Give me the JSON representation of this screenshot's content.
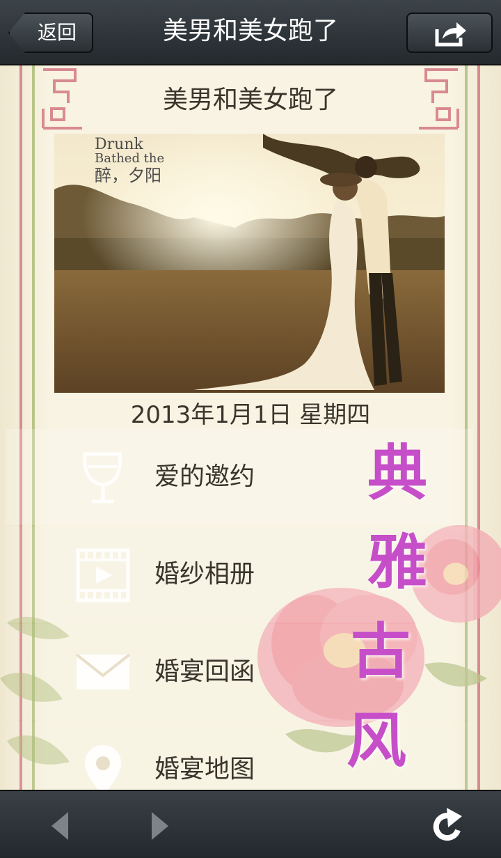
{
  "topbar": {
    "back_label": "返回",
    "title": "美男和美女跑了"
  },
  "card": {
    "heading": "美男和美女跑了",
    "photo_text": {
      "line1": "Drunk",
      "line2": "Bathed the",
      "line3": "醉，夕阳"
    },
    "date": "2013年1月1日 星期四"
  },
  "menu": {
    "items": [
      {
        "label": "爱的邀约",
        "icon": "wine-glass-icon"
      },
      {
        "label": "婚纱相册",
        "icon": "film-icon"
      },
      {
        "label": "婚宴回函",
        "icon": "envelope-icon"
      },
      {
        "label": "婚宴地图",
        "icon": "map-pin-icon"
      }
    ]
  },
  "decoration": {
    "calligraphy": [
      "典",
      "雅",
      "古",
      "风"
    ]
  },
  "bottombar": {
    "back_icon": "arrow-left-icon",
    "forward_icon": "arrow-right-icon",
    "refresh_icon": "refresh-icon"
  },
  "colors": {
    "bar_dark": "#2b3135",
    "frame_red": "#d8848a",
    "frame_green": "#b5c486",
    "calligraphy": "#c64fc9",
    "peony": "#ef8c98"
  }
}
